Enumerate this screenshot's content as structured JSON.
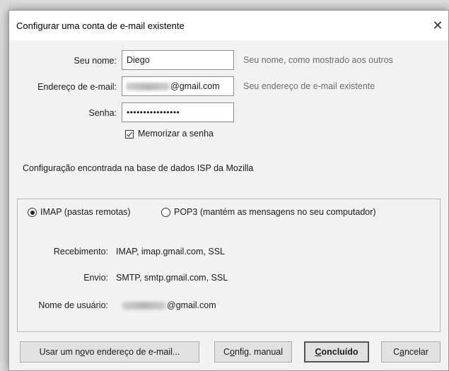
{
  "window": {
    "title": "Configurar uma conta de e-mail existente"
  },
  "form": {
    "name_label": "Seu nome:",
    "name_value": "Diego",
    "name_hint": "Seu nome, como mostrado aos outros",
    "email_label": "Endereço de e-mail:",
    "email_value_suffix": "@gmail.com",
    "email_hint": "Seu endereço de e-mail existente",
    "password_label": "Senha:",
    "password_mask": "••••••••••••••••",
    "remember_label": "Memorizar a senha",
    "remember_checked": true
  },
  "status_text": "Configuração encontrada na base de dados ISP da Mozilla",
  "protocol": {
    "imap_label": "IMAP (pastas remotas)",
    "pop3_label": "POP3 (mantém as mensagens no seu computador)",
    "selected": "IMAP"
  },
  "server_info": {
    "incoming_label": "Recebimento:",
    "incoming_value": "IMAP, imap.gmail.com, SSL",
    "outgoing_label": "Envio:",
    "outgoing_value": "SMTP, smtp.gmail.com, SSL",
    "username_label": "Nome de usuário:",
    "username_value_suffix": "@gmail.com"
  },
  "buttons": {
    "new_address_pre": "Usar um n",
    "new_address_u": "o",
    "new_address_post": "vo endereço de e-mail...",
    "manual_pre": "C",
    "manual_u": "o",
    "manual_post": "nfig. manual",
    "done_u": "C",
    "done_post": "oncluído",
    "cancel_pre": "C",
    "cancel_u": "a",
    "cancel_post": "ncelar"
  },
  "icons": {
    "close": "close-icon"
  }
}
